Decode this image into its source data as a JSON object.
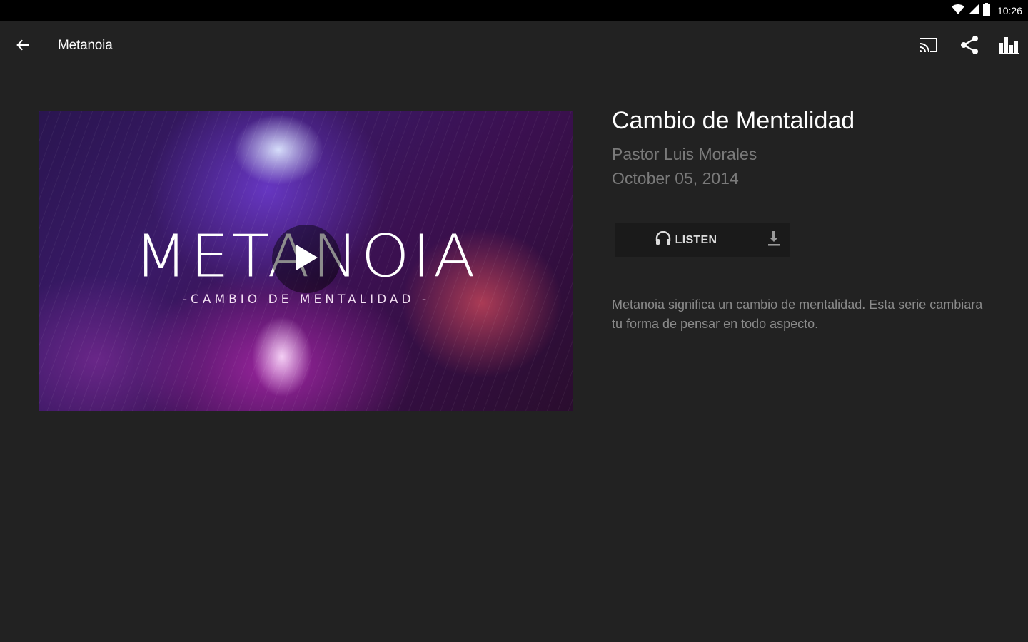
{
  "status_bar": {
    "time": "10:26",
    "icons": [
      "wifi-icon",
      "cell-signal-icon",
      "battery-icon"
    ]
  },
  "app_bar": {
    "title": "Metanoia",
    "back_icon": "arrow-left-icon",
    "actions": [
      "cast-icon",
      "share-icon",
      "bar-chart-icon"
    ]
  },
  "hero": {
    "title": "METANOIA",
    "subtitle": "-CAMBIO DE MENTALIDAD -",
    "play_icon": "play-icon"
  },
  "sermon": {
    "title": "Cambio de Mentalidad",
    "speaker": "Pastor Luis Morales",
    "date": "October 05, 2014",
    "listen_label": "LISTEN",
    "listen_icon": "headphones-icon",
    "download_icon": "download-icon",
    "description": "Metanoia significa un cambio de mentalidad. Esta serie cambiara tu forma de pensar en todo aspecto."
  },
  "colors": {
    "background": "#222222",
    "status_bar": "#000000",
    "muted_text": "#7a7a7a",
    "button_bg": "#1a1a1a"
  }
}
